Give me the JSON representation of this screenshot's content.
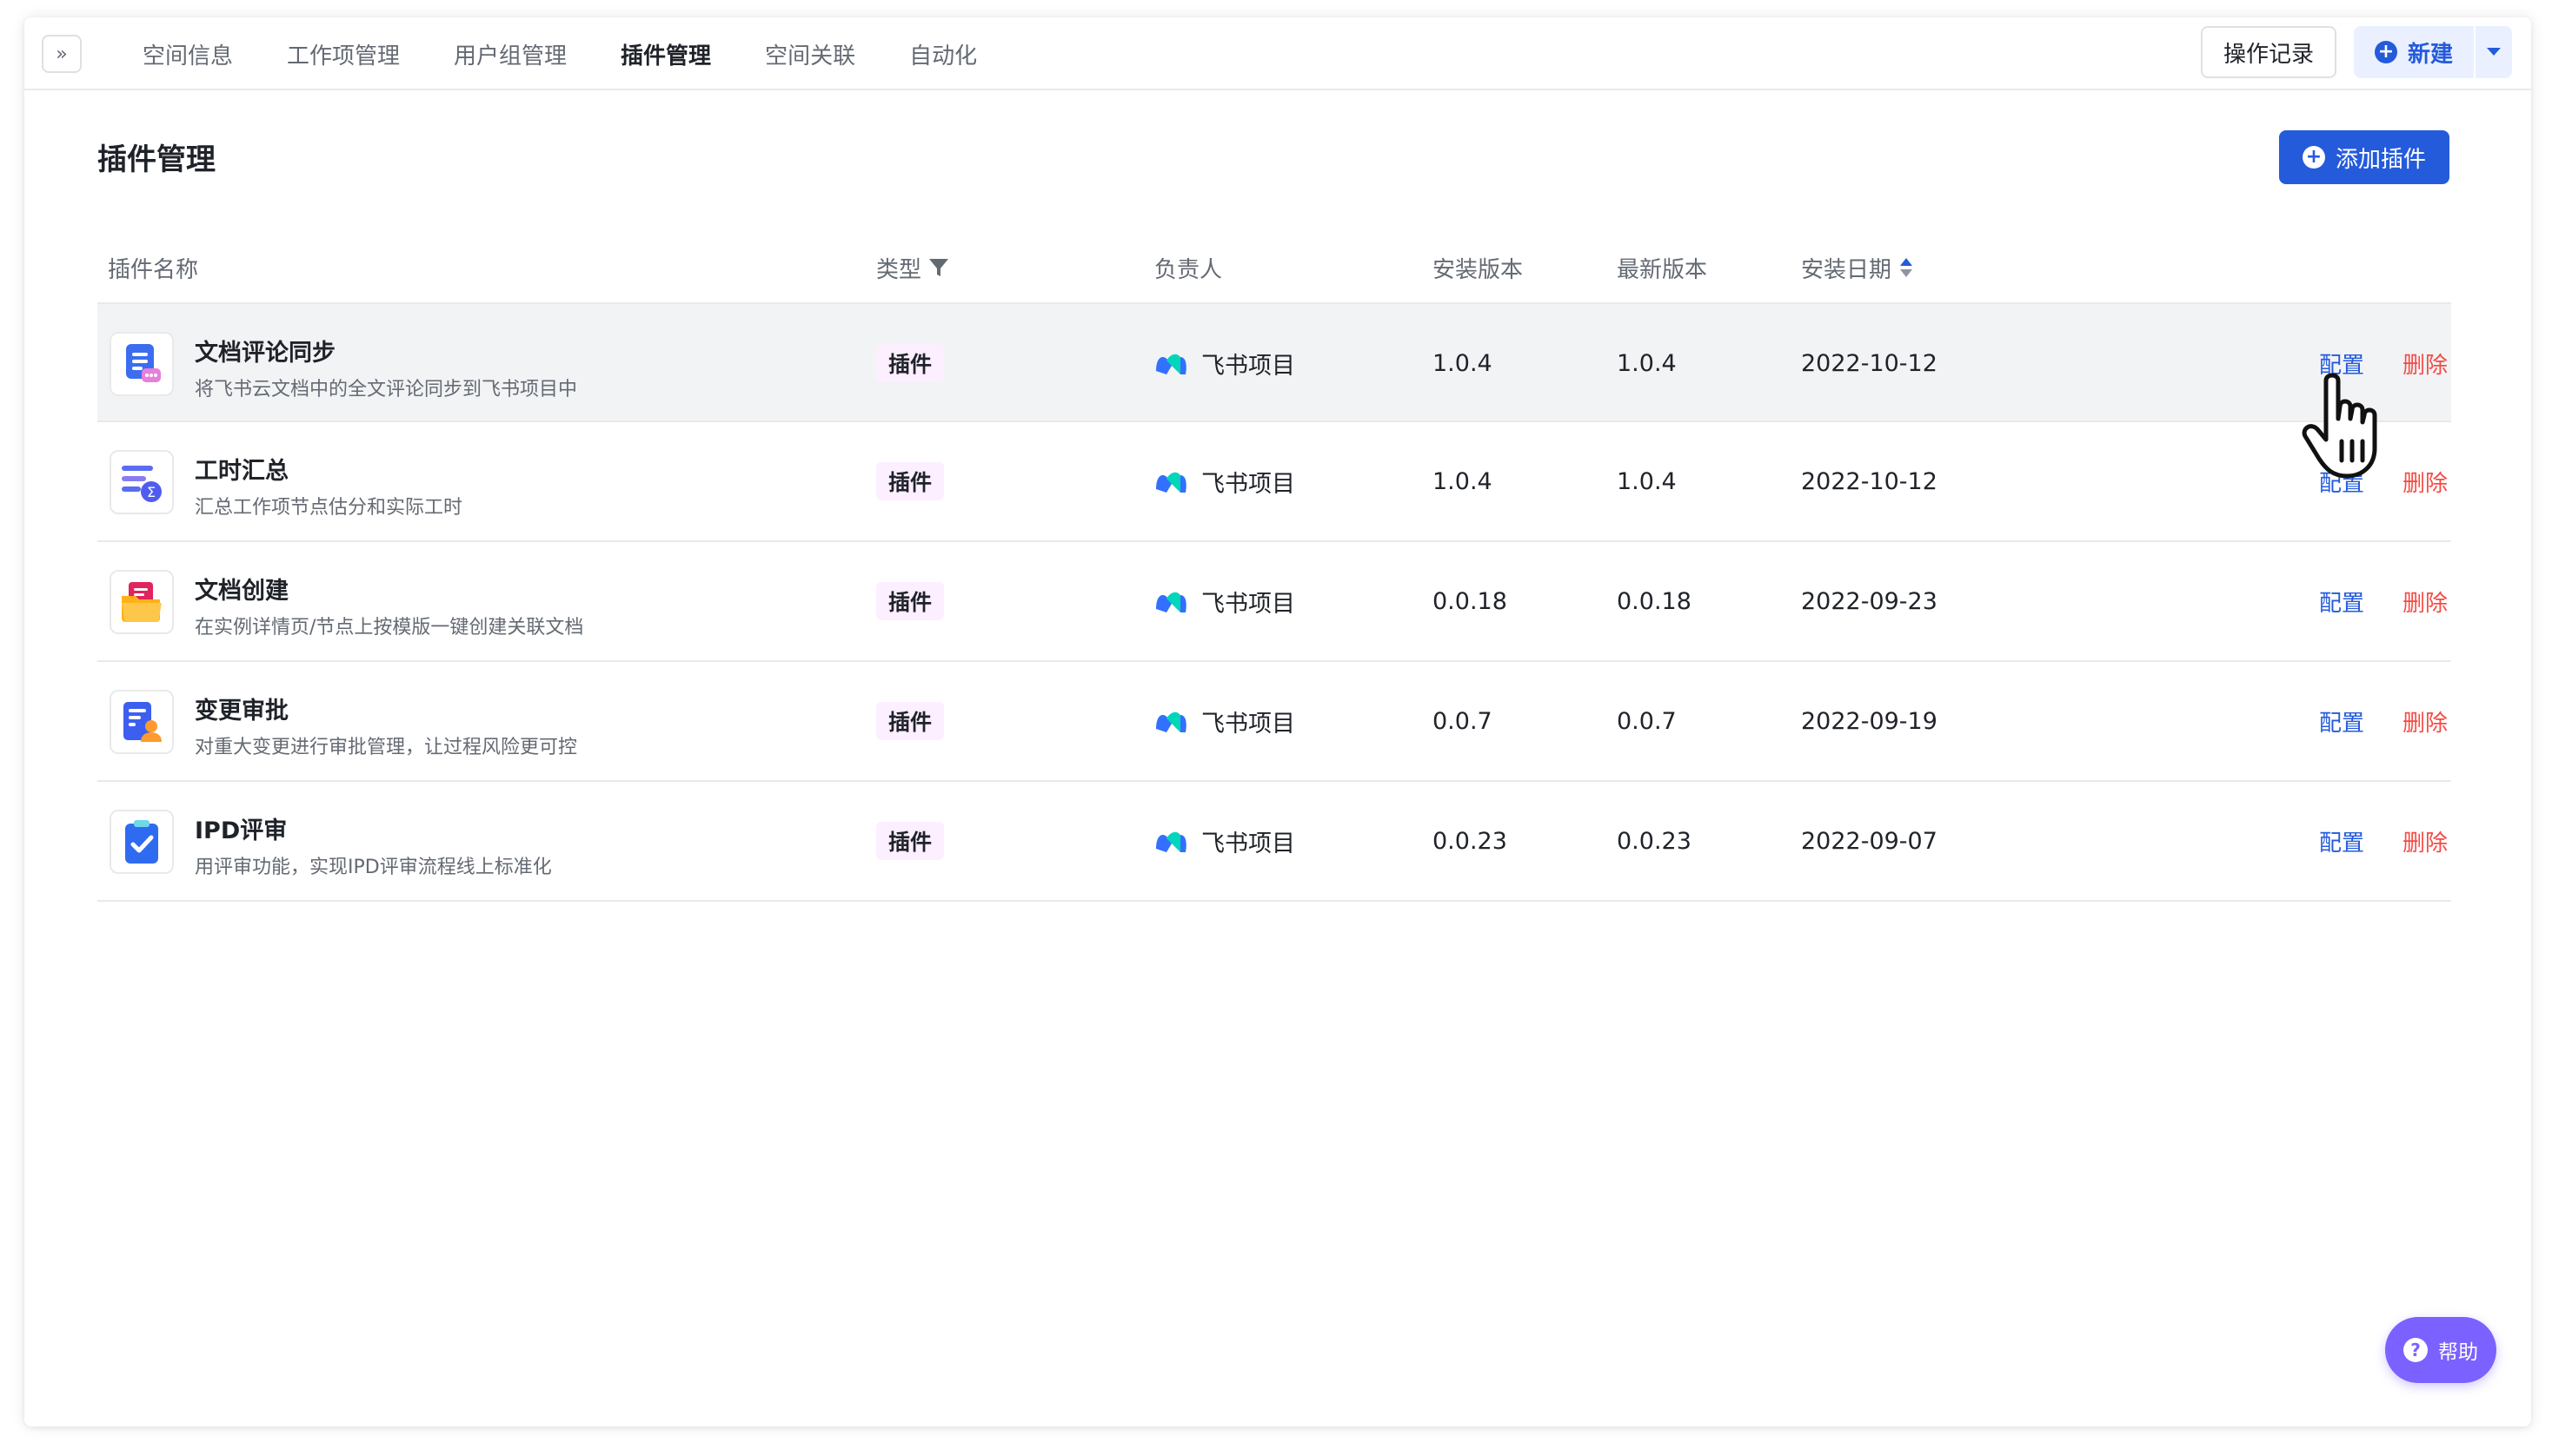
{
  "nav": {
    "expand_icon": "double-chevron-right-icon",
    "expand_glyph": "»",
    "tabs": [
      {
        "label": "空间信息",
        "active": false
      },
      {
        "label": "工作项管理",
        "active": false
      },
      {
        "label": "用户组管理",
        "active": false
      },
      {
        "label": "插件管理",
        "active": true
      },
      {
        "label": "空间关联",
        "active": false
      },
      {
        "label": "自动化",
        "active": false
      }
    ],
    "log_label": "操作记录",
    "new_label": "新建",
    "new_plus": "+"
  },
  "page": {
    "title": "插件管理",
    "add_label": "添加插件",
    "add_plus": "+"
  },
  "table": {
    "columns": {
      "name": "插件名称",
      "type": "类型",
      "owner": "负责人",
      "installed": "安装版本",
      "latest": "最新版本",
      "date": "安装日期"
    },
    "rows": [
      {
        "name": "文档评论同步",
        "desc": "将飞书云文档中的全文评论同步到飞书项目中",
        "type": "插件",
        "owner": "飞书项目",
        "installed": "1.0.4",
        "latest": "1.0.4",
        "date": "2022-10-12",
        "config": "配置",
        "delete": "删除",
        "icon": "doc-comment-icon"
      },
      {
        "name": "工时汇总",
        "desc": "汇总工作项节点估分和实际工时",
        "type": "插件",
        "owner": "飞书项目",
        "installed": "1.0.4",
        "latest": "1.0.4",
        "date": "2022-10-12",
        "config": "配置",
        "delete": "删除",
        "icon": "sum-list-icon"
      },
      {
        "name": "文档创建",
        "desc": "在实例详情页/节点上按模版一键创建关联文档",
        "type": "插件",
        "owner": "飞书项目",
        "installed": "0.0.18",
        "latest": "0.0.18",
        "date": "2022-09-23",
        "config": "配置",
        "delete": "删除",
        "icon": "folder-doc-icon"
      },
      {
        "name": "变更审批",
        "desc": "对重大变更进行审批管理，让过程风险更可控",
        "type": "插件",
        "owner": "飞书项目",
        "installed": "0.0.7",
        "latest": "0.0.7",
        "date": "2022-09-19",
        "config": "配置",
        "delete": "删除",
        "icon": "approval-doc-icon"
      },
      {
        "name": "IPD评审",
        "desc": "用评审功能，实现IPD评审流程线上标准化",
        "type": "插件",
        "owner": "飞书项目",
        "installed": "0.0.23",
        "latest": "0.0.23",
        "date": "2022-09-07",
        "config": "配置",
        "delete": "删除",
        "icon": "clipboard-check-icon"
      }
    ]
  },
  "help": {
    "label": "帮助",
    "glyph": "?"
  },
  "colors": {
    "accent": "#245bdb",
    "danger": "#f54a45",
    "help": "#7b61ff",
    "tag_bg": "#fcefff"
  }
}
